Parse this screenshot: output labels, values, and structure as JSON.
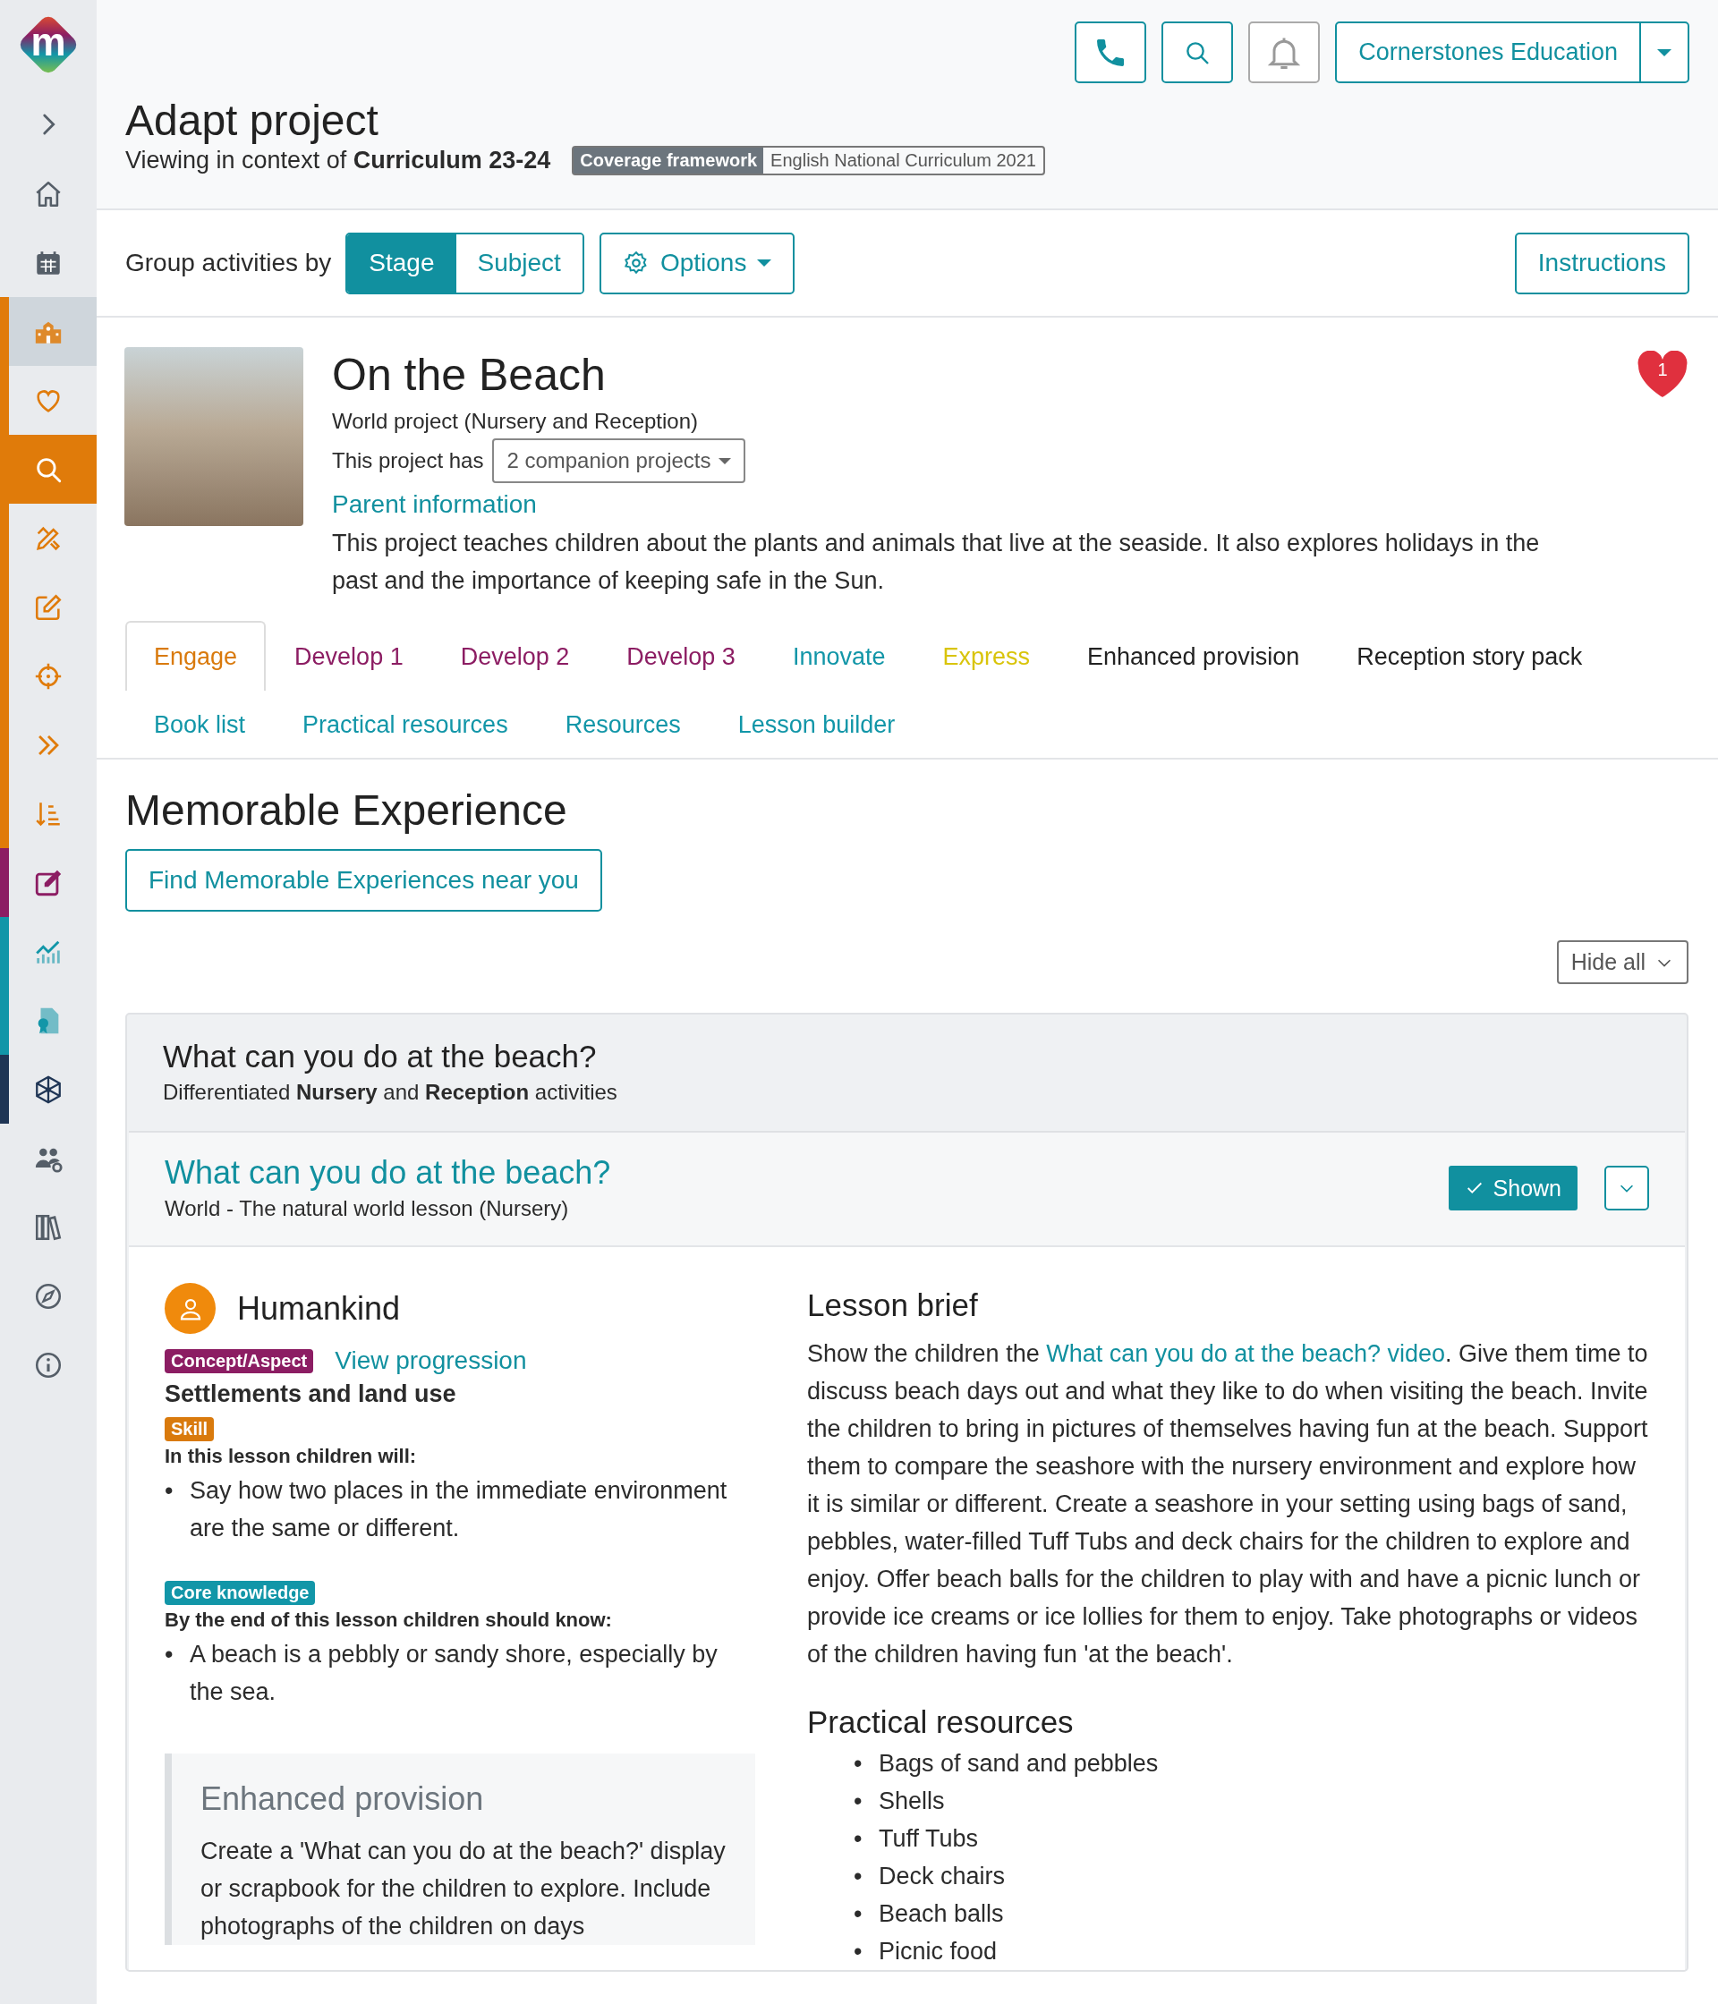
{
  "sidebar": {
    "logo_letter": "m",
    "items": [
      {
        "selected": false,
        "highlighted": false
      },
      {
        "selected": false,
        "highlighted": false
      },
      {
        "selected": false,
        "highlighted": true,
        "color": "#e07b0a"
      },
      {
        "selected": false,
        "highlighted": false,
        "color": "#e07b0a"
      },
      {
        "selected": true,
        "highlighted": false,
        "color": "#e07b0a"
      },
      {
        "selected": false,
        "highlighted": false,
        "color": "#e07b0a"
      },
      {
        "selected": false,
        "highlighted": false,
        "color": "#e07b0a"
      },
      {
        "selected": false,
        "highlighted": false,
        "color": "#e07b0a"
      },
      {
        "selected": false,
        "highlighted": false,
        "color": "#e07b0a"
      },
      {
        "selected": false,
        "highlighted": false,
        "color": "#e07b0a"
      },
      {
        "selected": false,
        "highlighted": false,
        "color": "#8c1d63"
      },
      {
        "selected": false,
        "highlighted": false,
        "color": "#1296a8"
      },
      {
        "selected": false,
        "highlighted": false,
        "color": "#1296a8"
      },
      {
        "selected": false,
        "highlighted": false,
        "color": "#1f3555"
      },
      {
        "selected": false,
        "highlighted": false
      },
      {
        "selected": false,
        "highlighted": false
      },
      {
        "selected": false,
        "highlighted": false
      },
      {
        "selected": false,
        "highlighted": false
      }
    ]
  },
  "top_bar": {
    "notifications_disabled": true,
    "account": "Cornerstones Education"
  },
  "header": {
    "title": "Adapt project",
    "context": "Viewing in context of **Curriculum 23-24**",
    "framework_label": "Coverage framework",
    "framework_value": "English National Curriculum 2021"
  },
  "toolbar": {
    "group_label": "Group activities by",
    "group_options": [
      {
        "label": "Stage",
        "selected": true
      },
      {
        "label": "Subject",
        "selected": false
      }
    ],
    "options": "Options",
    "instructions": "Instructions"
  },
  "project": {
    "title": "On the Beach",
    "subtitle": "World project (Nursery and Reception)",
    "companion_prefix": "This project has",
    "companion_select": "2 companion projects",
    "parent_link": "Parent information",
    "description": "This project teaches children about the plants and animals that live at the seaside. It also explores holidays in the past and the importance of keeping safe in the Sun.",
    "favourites": "1"
  },
  "tab_rows": [
    {
      "tabs": [
        {
          "label": "Engage",
          "color": "#d97a0d",
          "selected": true
        },
        {
          "label": "Develop 1",
          "color": "#8c1d63",
          "selected": false
        },
        {
          "label": "Develop 2",
          "color": "#8c1d63",
          "selected": false
        },
        {
          "label": "Develop 3",
          "color": "#8c1d63",
          "selected": false
        },
        {
          "label": "Innovate",
          "color": "#1296a8",
          "selected": false
        },
        {
          "label": "Express",
          "color": "#d9c40a",
          "selected": false
        },
        {
          "label": "Enhanced provision",
          "color": "#222222",
          "selected": false
        },
        {
          "label": "Reception story pack",
          "color": "#222222",
          "selected": false
        }
      ]
    },
    {
      "tabs": [
        {
          "label": "Book list",
          "color": "#1296a8",
          "selected": false
        },
        {
          "label": "Practical resources",
          "color": "#1296a8",
          "selected": false
        },
        {
          "label": "Resources",
          "color": "#1296a8",
          "selected": false
        },
        {
          "label": "Lesson builder",
          "color": "#1296a8",
          "selected": false
        }
      ]
    }
  ],
  "section": {
    "heading": "Memorable Experience",
    "find_button": "Find Memorable Experiences near you",
    "hide_all": "Hide all"
  },
  "group": {
    "title": "What can you do at the beach?",
    "subtitle": "Differentiated **Nursery** and **Reception** activities",
    "activity": {
      "title": "What can you do at the beach?",
      "subtitle": "World - The natural world lesson (Nursery)",
      "shown_label": "Shown",
      "shown": true,
      "expanded": false,
      "bullet": "•",
      "subject": "Humankind",
      "concept_tag": "Concept/Aspect",
      "view_progression": "View progression",
      "concept": "Settlements and land use",
      "skill_tag": "Skill",
      "skill_intro": "In this lesson children will:",
      "skill_points": [
        "Say how two places in the immediate environment are the same or different."
      ],
      "knowledge_tag": "Core knowledge",
      "knowledge_intro": "By the end of this lesson children should know:",
      "knowledge_points": [
        "A beach is a pebbly or sandy shore, especially by the sea."
      ],
      "enhanced_heading": "Enhanced provision",
      "enhanced_text": "Create a 'What can you do at the beach?' display or scrapbook for the children to explore. Include photographs of the children on days",
      "brief_heading": "Lesson brief",
      "brief_before": "Show the children the",
      "brief_link": "What can you do at the beach? video",
      "brief_after": ". Give them time to discuss beach days out and what they like to do when visiting the beach. Invite the children to bring in pictures of themselves having fun at the beach. Support them to compare the seashore with the nursery environment and explore how it is similar or different. Create a seashore in your setting using bags of sand, pebbles, water-filled Tuff Tubs and deck chairs for the children to explore and enjoy. Offer beach balls for the children to play with and have a picnic lunch or provide ice creams or ice lollies for them to enjoy. Take photographs or videos of the children having fun 'at the beach'.",
      "resources_heading": "Practical resources",
      "resources": [
        "Bags of sand and pebbles",
        "Shells",
        "Tuff Tubs",
        "Deck chairs",
        "Beach balls",
        "Picnic food"
      ]
    }
  }
}
